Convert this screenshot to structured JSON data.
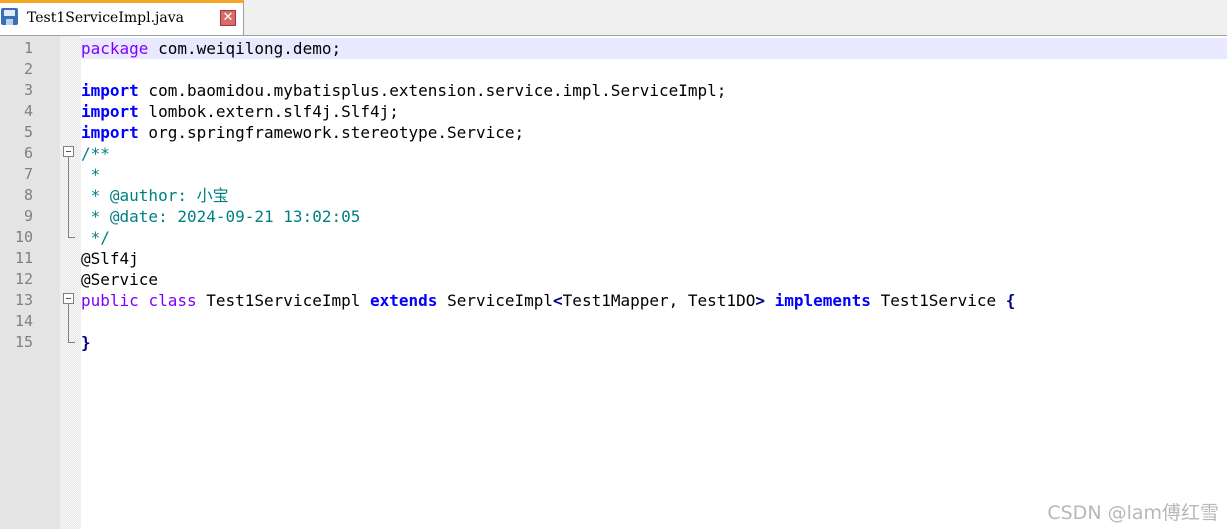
{
  "tab": {
    "filename": "Test1ServiceImpl.java",
    "close_label": "✕"
  },
  "lines": [
    {
      "n": "1"
    },
    {
      "n": "2"
    },
    {
      "n": "3"
    },
    {
      "n": "4"
    },
    {
      "n": "5"
    },
    {
      "n": "6"
    },
    {
      "n": "7"
    },
    {
      "n": "8"
    },
    {
      "n": "9"
    },
    {
      "n": "10"
    },
    {
      "n": "11"
    },
    {
      "n": "12"
    },
    {
      "n": "13"
    },
    {
      "n": "14"
    },
    {
      "n": "15"
    }
  ],
  "code": {
    "l1_kw": "package",
    "l1_rest": " com.weiqilong.demo;",
    "l3_kw": "import",
    "l3_rest": " com.baomidou.mybatisplus.extension.service.impl.ServiceImpl;",
    "l4_kw": "import",
    "l4_rest": " lombok.extern.slf4j.Slf4j;",
    "l5_kw": "import",
    "l5_rest": " org.springframework.stereotype.Service;",
    "l6": "/**",
    "l7": " *",
    "l8": " * @author: 小宝",
    "l9": " * @date: 2024-09-21 13:02:05",
    "l10": " */",
    "l11": "@Slf4j",
    "l12": "@Service",
    "l13_public": "public",
    "l13_class": "class",
    "l13_name": " Test1ServiceImpl ",
    "l13_extends": "extends",
    "l13_super": " ServiceImpl",
    "l13_lt": "<",
    "l13_generic": "Test1Mapper, Test1DO",
    "l13_gt": ">",
    "l13_implements": "implements",
    "l13_iface": " Test1Service ",
    "l13_brace": "{",
    "l15": "}"
  },
  "watermark": "CSDN @lam傅红雪"
}
